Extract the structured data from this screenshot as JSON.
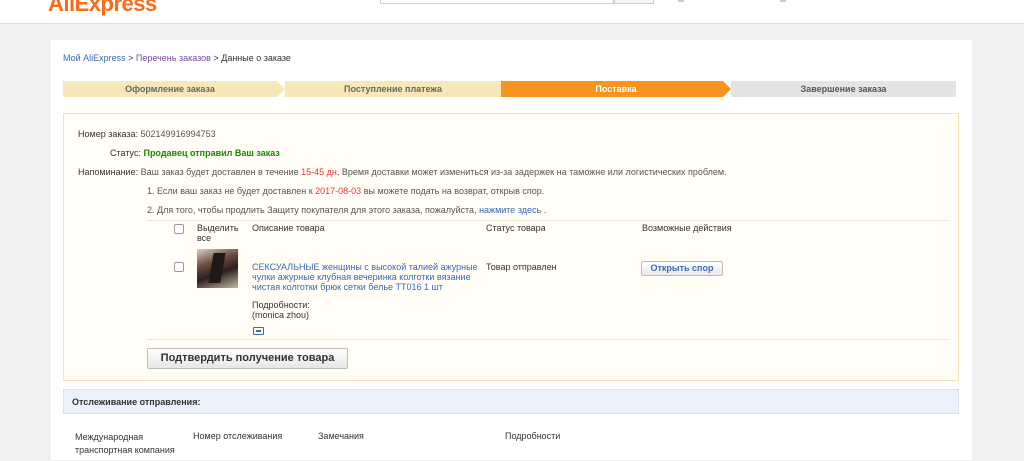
{
  "header": {
    "logo_text": "AliExpress"
  },
  "breadcrumb": {
    "item1": "Мой AliExpress",
    "sep1": " > ",
    "item2": "Перечень заказов",
    "sep2": " > ",
    "item3": "Данные о заказе"
  },
  "steps": [
    {
      "label": "Оформление заказа",
      "state": "done"
    },
    {
      "label": "Поступление платежа",
      "state": "done"
    },
    {
      "label": "Поставка",
      "state": "active"
    },
    {
      "label": "Завершение заказа",
      "state": "todo"
    }
  ],
  "order": {
    "number_label": "Номер заказа:",
    "number_value": "502149916994753",
    "status_label": "Статус:",
    "status_value": "Продавец отправил Ваш заказ",
    "reminder_label": "Напоминание:",
    "reminder_part1": "Ваш заказ будет доставлен в течение ",
    "reminder_days": "15-45 дн",
    "reminder_part2": ", Время доставки может измениться из-за задержек на таможне или логистических проблем.",
    "note1_part1": "1. Если ваш заказ не будет доставлен к ",
    "note1_date": "2017-08-03",
    "note1_part2": " вы можете подать на возврат, открыв спор.",
    "note2_part1": "2. Для того, чтобы продлить Защиту покупателя для этого заказа, пожалуйста, ",
    "note2_link": "нажмите здесь",
    "note2_part2": " ."
  },
  "table": {
    "col_select_line1": "Выделить",
    "col_select_line2": "все",
    "col_description": "Описание товара",
    "col_status": "Статус товара",
    "col_actions": "Возможные действия"
  },
  "item": {
    "title": "СЕКСУАЛЬНЫЕ женщины с высокой талией ажурные чулки ажурные клубная вечеринка колготки вязание чистая колготки брюк сетки белье TT016 1 шт",
    "details_label": "Подробности:",
    "details_value": "(monica zhou)",
    "status": "Товар отправлен",
    "dispute_button": "Открыть спор"
  },
  "confirm_button": "Подтвердить получение товара",
  "tracking": {
    "title": "Отслеживание отправления:",
    "col1": "Международная транспортная компания",
    "col2": "Номер отслеживания",
    "col3": "Замечания",
    "col4": "Подробности"
  },
  "colors": {
    "accent_orange": "#f7941d",
    "step_done": "#f8e7b8",
    "step_todo": "#e4e4e4",
    "status_green": "#178a00",
    "warning_red": "#e4393c",
    "link_blue": "#3a6ab1"
  },
  "icons": {
    "item_snapshot": "snapshot-icon"
  }
}
